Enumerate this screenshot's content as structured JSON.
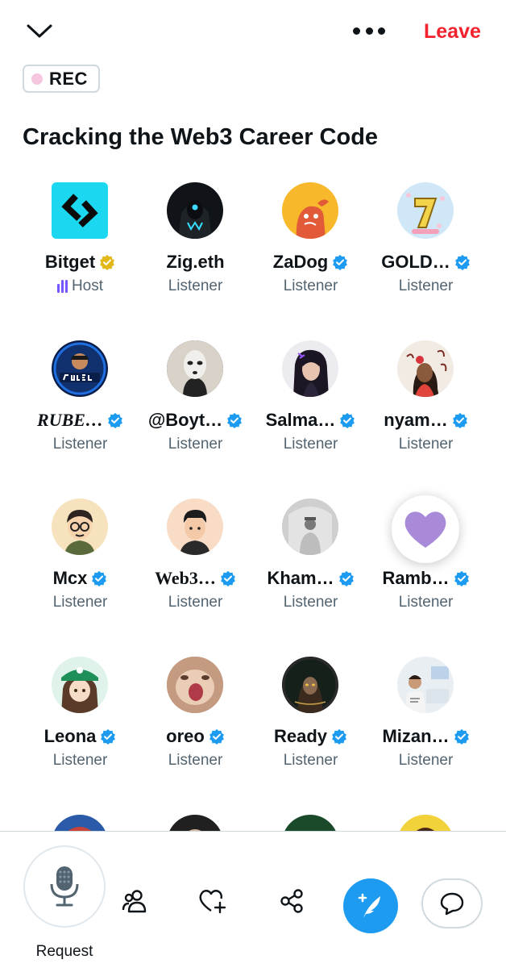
{
  "header": {
    "leave_label": "Leave",
    "rec_label": "REC"
  },
  "space": {
    "title": "Cracking the Web3 Career Code"
  },
  "participants": [
    {
      "name": "Bitget",
      "role": "Host",
      "badge": "gold-verified"
    },
    {
      "name": "Zig.eth",
      "role": "Listener",
      "badge": "none"
    },
    {
      "name": "ZaDog",
      "role": "Listener",
      "badge": "blue-verified"
    },
    {
      "name": "GOLD…",
      "role": "Listener",
      "badge": "blue-verified"
    },
    {
      "name": "RUBE…",
      "role": "Listener",
      "badge": "blue-verified"
    },
    {
      "name": "@Boyt…",
      "role": "Listener",
      "badge": "blue-verified"
    },
    {
      "name": "Salma…",
      "role": "Listener",
      "badge": "blue-verified"
    },
    {
      "name": "nyam…",
      "role": "Listener",
      "badge": "blue-verified"
    },
    {
      "name": "Mcx",
      "role": "Listener",
      "badge": "blue-verified"
    },
    {
      "name": "Web3…",
      "role": "Listener",
      "badge": "blue-verified"
    },
    {
      "name": "Kham…",
      "role": "Listener",
      "badge": "blue-verified"
    },
    {
      "name": "Ramb…",
      "role": "Listener",
      "badge": "blue-verified"
    },
    {
      "name": "Leona",
      "role": "Listener",
      "badge": "blue-verified"
    },
    {
      "name": "oreo",
      "role": "Listener",
      "badge": "blue-verified"
    },
    {
      "name": "Ready",
      "role": "Listener",
      "badge": "blue-verified"
    },
    {
      "name": "Mizan…",
      "role": "Listener",
      "badge": "blue-verified"
    }
  ],
  "bottom_bar": {
    "request_label": "Request"
  },
  "icons": {
    "collapse": "chevron-down-icon",
    "more": "more-horizontal-icon",
    "mic": "microphone-icon",
    "people": "people-icon",
    "heart_add": "heart-plus-icon",
    "share": "share-icon",
    "compose": "compose-feather-icon",
    "comment": "comment-bubble-icon"
  },
  "colors": {
    "leave": "#f4212e",
    "accent": "#1d9bf0",
    "verified_blue": "#1d9bf0",
    "verified_gold": "#e2b719",
    "host_purple": "#7856ff",
    "reaction_heart": "#a98ad9",
    "rec_dot": "#f6c6df"
  }
}
